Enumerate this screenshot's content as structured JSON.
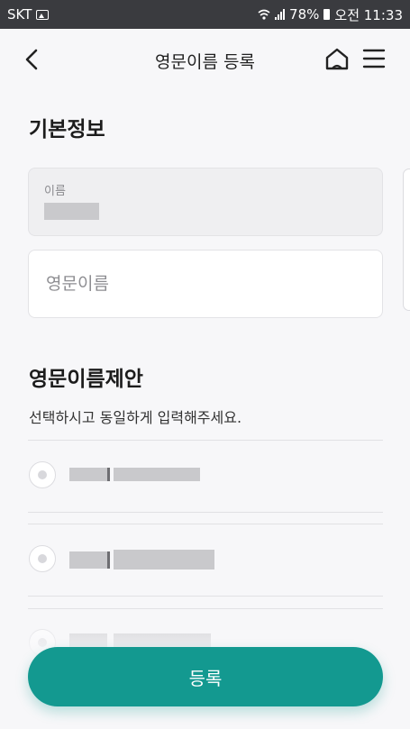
{
  "status_bar": {
    "carrier": "SKT",
    "battery": "78%",
    "time": "오전 11:33"
  },
  "header": {
    "title": "영문이름 등록",
    "icons": [
      "back-arrow",
      "home",
      "hamburger-menu"
    ]
  },
  "basic_info": {
    "section_title": "기본정보",
    "name_label": "이름",
    "english_name_placeholder": "영문이름"
  },
  "suggestion": {
    "section_title": "영문이름제안",
    "instruction": "선택하시고 동일하게 입력해주세요."
  },
  "submit_label": "등록",
  "colors": {
    "accent": "#139990",
    "status_bar": "#3a3b3f",
    "background": "#f7f7f9"
  }
}
